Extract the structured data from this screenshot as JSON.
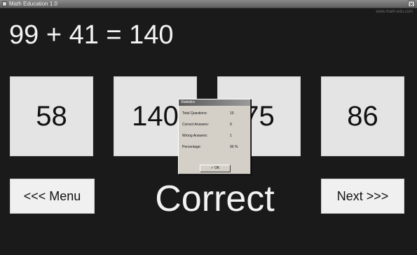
{
  "window": {
    "title": "Math Education 1.0",
    "close_label": "✕",
    "version_text": "www.math-edu.com"
  },
  "question": {
    "equation": "99 + 41 = 140"
  },
  "answers": [
    "58",
    "140",
    "75",
    "86"
  ],
  "nav": {
    "menu_label": "<<< Menu",
    "next_label": "Next >>>"
  },
  "result_text": "Correct",
  "statistics_dialog": {
    "title": "Statistics",
    "rows": [
      {
        "label": "Total Questions:",
        "value": "10"
      },
      {
        "label": "Correct Answers:",
        "value": "9"
      },
      {
        "label": "Wrong Answers:",
        "value": "1"
      },
      {
        "label": "Percentage:",
        "value": "90 %"
      }
    ],
    "ok_label": "✓ OK"
  },
  "colors": {
    "background": "#1a1a1a",
    "card": "#e4e4e4",
    "text_light": "#f4f4f4"
  }
}
